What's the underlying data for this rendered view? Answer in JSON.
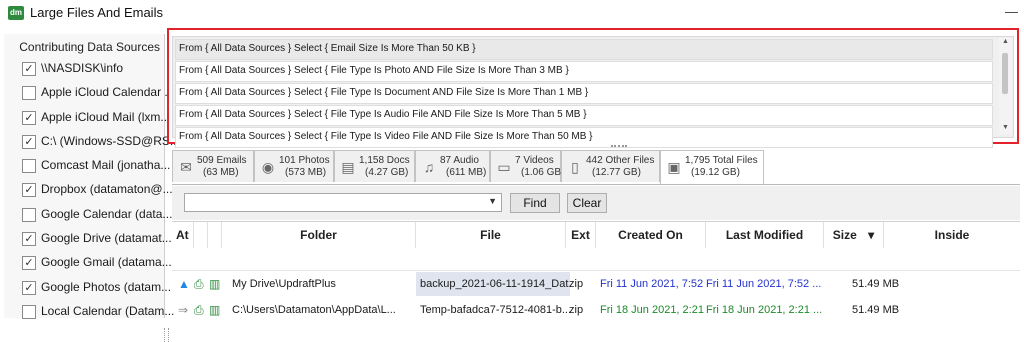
{
  "window": {
    "title": "Large Files And Emails",
    "logo_text": "dm",
    "minimize_glyph": "—"
  },
  "sidebar": {
    "header": "Contributing Data Sources",
    "items": [
      {
        "label": "\\\\NASDISK\\info",
        "checked": true
      },
      {
        "label": "Apple iCloud Calendar ...",
        "checked": false
      },
      {
        "label": "Apple iCloud Mail (lxm...",
        "checked": true
      },
      {
        "label": "C:\\ (Windows-SSD@RS...",
        "checked": true
      },
      {
        "label": "Comcast Mail (jonatha...",
        "checked": false
      },
      {
        "label": "Dropbox (datamaton@...",
        "checked": true
      },
      {
        "label": "Google Calendar (data...",
        "checked": false
      },
      {
        "label": "Google Drive (datamat...",
        "checked": true
      },
      {
        "label": "Google Gmail (datama...",
        "checked": true
      },
      {
        "label": "Google Photos (datam...",
        "checked": true
      },
      {
        "label": "Local Calendar (Datam...",
        "checked": false
      }
    ]
  },
  "criteria": [
    "From { All Data Sources } Select { Email Size Is More Than 50 KB }",
    "From { All Data Sources } Select { File Type Is Photo AND File Size Is More Than 3 MB }",
    "From { All Data Sources } Select { File Type Is Document AND File Size Is More Than 1 MB }",
    "From { All Data Sources } Select { File Type Is Audio File AND File Size Is More Than 5 MB }",
    "From { All Data Sources } Select { File Type Is Video File AND File Size Is More Than 50 MB }"
  ],
  "tabs": [
    {
      "line1": "509 Emails",
      "line2": "(63 MB)",
      "icon": "envelope-icon",
      "glyph": "✉"
    },
    {
      "line1": "101 Photos",
      "line2": "(573 MB)",
      "icon": "camera-icon",
      "glyph": "◉"
    },
    {
      "line1": "1,158 Docs",
      "line2": "(4.27 GB)",
      "icon": "document-icon",
      "glyph": "▤"
    },
    {
      "line1": "87 Audio",
      "line2": "(611 MB)",
      "icon": "music-note-icon",
      "glyph": "♫"
    },
    {
      "line1": "7 Videos",
      "line2": "(1.06 GB)",
      "icon": "video-icon",
      "glyph": "▭"
    },
    {
      "line1": "442 Other Files",
      "line2": "(12.77 GB)",
      "icon": "file-icon",
      "glyph": "▯"
    },
    {
      "line1": "1,795 Total Files",
      "line2": "(19.12 GB)",
      "icon": "image-file-icon",
      "glyph": "▣"
    }
  ],
  "toolbar": {
    "find_label": "Find",
    "clear_label": "Clear",
    "combo_arrow": "▼"
  },
  "columns": {
    "at": "At",
    "folder": "Folder",
    "file": "File",
    "ext": "Ext",
    "created": "Created On",
    "modified": "Last Modified",
    "size": "Size",
    "size_sort": "▾",
    "inside": "Inside"
  },
  "rows": [
    {
      "folder": "My Drive\\UpdraftPlus",
      "file": "backup_2021-06-11-1914_Dat...",
      "ext": "zip",
      "created": "Fri 11 Jun 2021, 7:52 ...",
      "modified": "Fri 11 Jun 2021, 7:52 ...",
      "size": "51.49 MB",
      "source_icon": "google-drive-icon",
      "date_color": "#2233cc"
    },
    {
      "folder": "C:\\Users\\Datamaton\\AppData\\L...",
      "file": "Temp-bafadca7-7512-4081-b...",
      "ext": "zip",
      "created": "Fri 18 Jun 2021, 2:21 ...",
      "modified": "Fri 18 Jun 2021, 2:21 ...",
      "size": "51.49 MB",
      "source_icon": "share-icon",
      "date_color": "#1c8a2a"
    }
  ],
  "colors": {
    "highlight_border": "#e2232a",
    "accent_green": "#2e8b3e"
  }
}
